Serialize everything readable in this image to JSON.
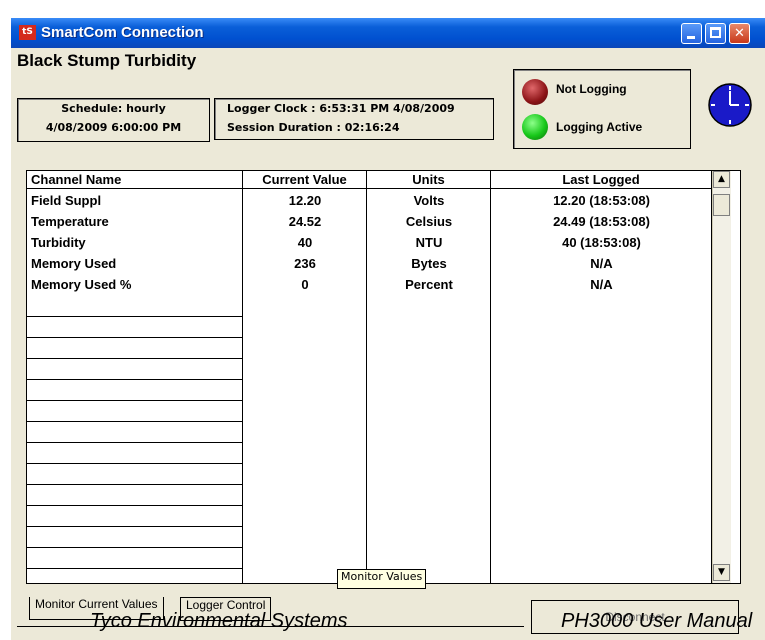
{
  "window": {
    "title": "SmartCom Connection",
    "icon_text": "tS"
  },
  "header": {
    "site_name": "Black Stump Turbidity",
    "schedule_label": "Schedule: hourly",
    "schedule_time": "4/08/2009 6:00:00 PM",
    "logger_clock": "Logger Clock : 6:53:31 PM 4/08/2009",
    "session_duration": "Session Duration : 02:16:24"
  },
  "status": {
    "not_logging": "Not Logging",
    "logging_active": "Logging Active",
    "colors": {
      "not_logging": "#8b1316",
      "logging_active": "#18c81a"
    }
  },
  "table": {
    "columns": [
      "Channel Name",
      "Current Value",
      "Units",
      "Last Logged"
    ],
    "rows": [
      [
        "Field Suppl",
        "12.20",
        "Volts",
        "12.20  (18:53:08)"
      ],
      [
        "Temperature",
        "24.52",
        "Celsius",
        "24.49  (18:53:08)"
      ],
      [
        "Turbidity",
        "40",
        "NTU",
        "40  (18:53:08)"
      ],
      [
        "Memory Used",
        "236",
        "Bytes",
        "N/A"
      ],
      [
        "Memory Used %",
        "0",
        "Percent",
        "N/A"
      ]
    ]
  },
  "tooltip": "Monitor Values",
  "tabs": [
    "Monitor Current Values",
    "Logger Control"
  ],
  "disconnect_label": "Disconnect",
  "footer": {
    "left": "Tyco Environmental Systems",
    "right": "PH3000 User Manual"
  }
}
